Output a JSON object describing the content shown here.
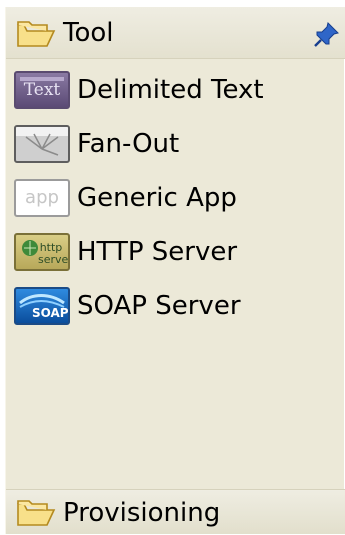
{
  "header": {
    "title": "Tool",
    "folder_icon": "folder-open-icon",
    "pin_icon": "pin-icon"
  },
  "items": [
    {
      "label": "Delimited Text",
      "icon": "delimited-text-icon",
      "icon_text": "Text"
    },
    {
      "label": "Fan-Out",
      "icon": "fan-out-icon",
      "icon_text": ""
    },
    {
      "label": "Generic App",
      "icon": "generic-app-icon",
      "icon_text": "app"
    },
    {
      "label": "HTTP Server",
      "icon": "http-server-icon",
      "icon_text": "http server"
    },
    {
      "label": "SOAP Server",
      "icon": "soap-server-icon",
      "icon_text": "SOAP"
    }
  ],
  "footer": {
    "title": "Provisioning",
    "folder_icon": "folder-open-icon"
  },
  "colors": {
    "panel_background": "#ece9d8",
    "header_background": "#e8e5d3",
    "folder_fill": "#f6d774",
    "pin_blue": "#1b4fb3"
  }
}
